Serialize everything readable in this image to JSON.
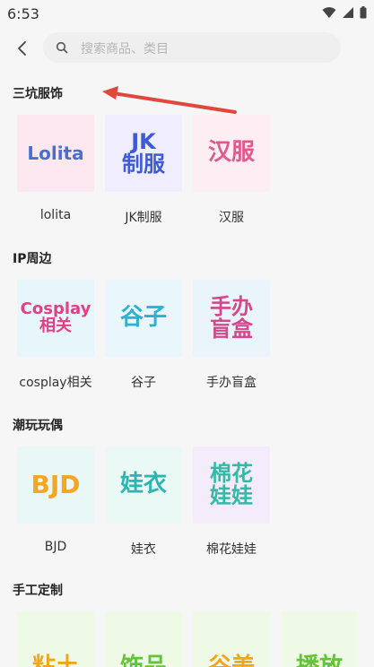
{
  "status": {
    "time": "6:53"
  },
  "search": {
    "placeholder": "搜索商品、类目"
  },
  "sections": [
    {
      "title": "三坑服饰",
      "items": [
        {
          "label": "lolita",
          "art": "Lolita",
          "color": "#4a6fd1",
          "bg": "#fde8f2"
        },
        {
          "label": "JK制服",
          "art": "JK\n制服",
          "color": "#3d5bd9",
          "bg": "#f0eefe"
        },
        {
          "label": "汉服",
          "art": "汉服",
          "color": "#e25a8b",
          "bg": "#fdeef3"
        }
      ]
    },
    {
      "title": "IP周边",
      "items": [
        {
          "label": "cosplay相关",
          "art": "Cosplay\n相关",
          "color": "#e23f86",
          "bg": "#e6f6fb"
        },
        {
          "label": "谷子",
          "art": "谷子",
          "color": "#2bb0d6",
          "bg": "#e9f6fb"
        },
        {
          "label": "手办盲盒",
          "art": "手办\n盲盒",
          "color": "#d4478a",
          "bg": "#eaf5fb"
        }
      ]
    },
    {
      "title": "潮玩玩偶",
      "items": [
        {
          "label": "BJD",
          "art": "BJD",
          "color": "#f5a623",
          "bg": "#e9f8f7"
        },
        {
          "label": "娃衣",
          "art": "娃衣",
          "color": "#2bb6b0",
          "bg": "#eaf8f6"
        },
        {
          "label": "棉花娃娃",
          "art": "棉花\n娃娃",
          "color": "#35b9a6",
          "bg": "#f5ecfb"
        }
      ]
    },
    {
      "title": "手工定制",
      "items": [
        {
          "label": "",
          "art": "粘土",
          "color": "#f2a516",
          "bg": "#eef9e6"
        },
        {
          "label": "",
          "art": "饰品",
          "color": "#63c437",
          "bg": "#eef9e6"
        },
        {
          "label": "",
          "art": "谷美",
          "color": "#f2a516",
          "bg": "#eef9e6"
        },
        {
          "label": "",
          "art": "播放",
          "color": "#63c437",
          "bg": "#eef9e6"
        }
      ]
    }
  ]
}
